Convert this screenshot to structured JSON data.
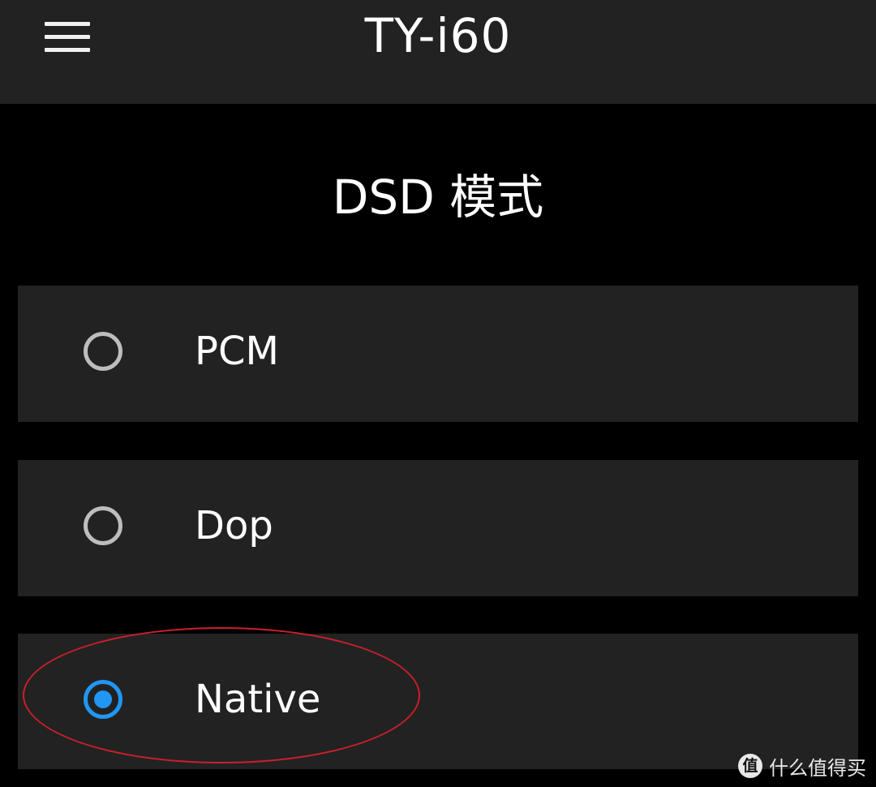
{
  "header": {
    "title": "TY-i60",
    "menu_icon": "hamburger-menu-icon"
  },
  "section": {
    "title": "DSD 模式"
  },
  "options": [
    {
      "label": "PCM",
      "selected": false
    },
    {
      "label": "Dop",
      "selected": false
    },
    {
      "label": "Native",
      "selected": true
    }
  ],
  "colors": {
    "background": "#000000",
    "panel": "#222222",
    "text": "#ffffff",
    "radio_unselected": "#bdbdbd",
    "radio_selected": "#2196f3",
    "annotation": "#cc1f2a"
  },
  "watermark": {
    "logo_text": "值",
    "text": "什么值得买"
  }
}
